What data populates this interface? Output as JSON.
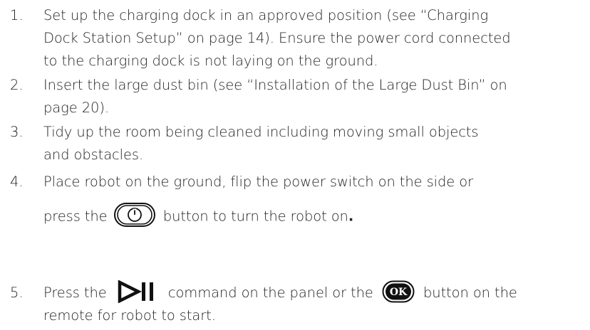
{
  "steps": [
    {
      "number": "1.",
      "lines": [
        "Set up the charging dock in an approved position (see “Charging",
        "Dock Station Setup” on page 14). Ensure the power cord connected",
        "to the charging dock is not laying on the ground."
      ]
    },
    {
      "number": "2.",
      "lines": [
        "Insert the large dust bin (see “Installation of the Large Dust Bin” on",
        "page 20)."
      ]
    },
    {
      "number": "3.",
      "lines": [
        "Tidy up the room being cleaned including moving small objects",
        "and obstacles."
      ]
    },
    {
      "number": "4.",
      "line1": "Place  robot  on the ground, flip the power switch on the side or",
      "line2_before": "press the",
      "line2_after": "button to turn the robot on",
      "line2_end": ".",
      "icon": "power-button-icon"
    },
    {
      "number": "5.",
      "line1_before": "Press the",
      "line1_middle": "command on the panel or the",
      "line1_after": "button on the",
      "line2": "remote for robot to start.",
      "icons": [
        "play-pause-icon",
        "ok-button-icon"
      ],
      "ok_label": "OK"
    }
  ],
  "colors": {
    "text": "#222222",
    "icon": "#111111",
    "background": "#ffffff"
  }
}
